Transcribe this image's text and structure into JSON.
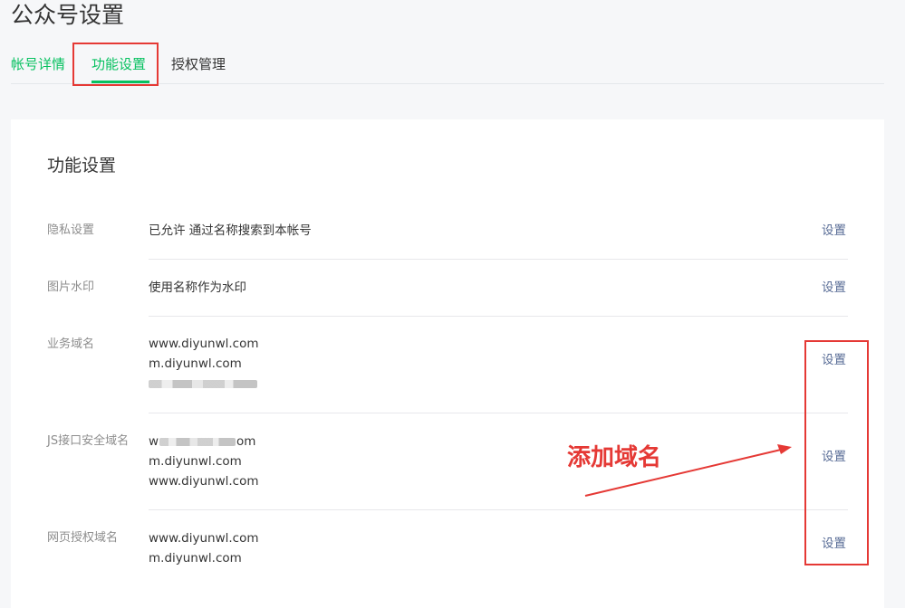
{
  "page": {
    "title": "公众号设置"
  },
  "tabs": [
    {
      "label": "帐号详情"
    },
    {
      "label": "功能设置"
    },
    {
      "label": "授权管理"
    }
  ],
  "card": {
    "title": "功能设置",
    "rows": [
      {
        "label": "隐私设置",
        "values": [
          "已允许 通过名称搜索到本帐号"
        ],
        "action": "设置"
      },
      {
        "label": "图片水印",
        "values": [
          "使用名称作为水印"
        ],
        "action": "设置"
      },
      {
        "label": "业务域名",
        "values": [
          "www.diyunwl.com",
          "m.diyunwl.com"
        ],
        "action": "设置"
      },
      {
        "label": "JS接口安全域名",
        "values": [
          "m.diyunwl.com",
          "www.diyunwl.com"
        ],
        "partial_values": [
          "w",
          "om"
        ],
        "action": "设置"
      },
      {
        "label": "网页授权域名",
        "values": [
          "www.diyunwl.com",
          "m.diyunwl.com"
        ],
        "action": "设置"
      }
    ]
  },
  "annotation": {
    "text": "添加域名",
    "color": "#e53935"
  },
  "colors": {
    "accent": "#07c160",
    "link": "#576b95",
    "annotation": "#e53935"
  }
}
